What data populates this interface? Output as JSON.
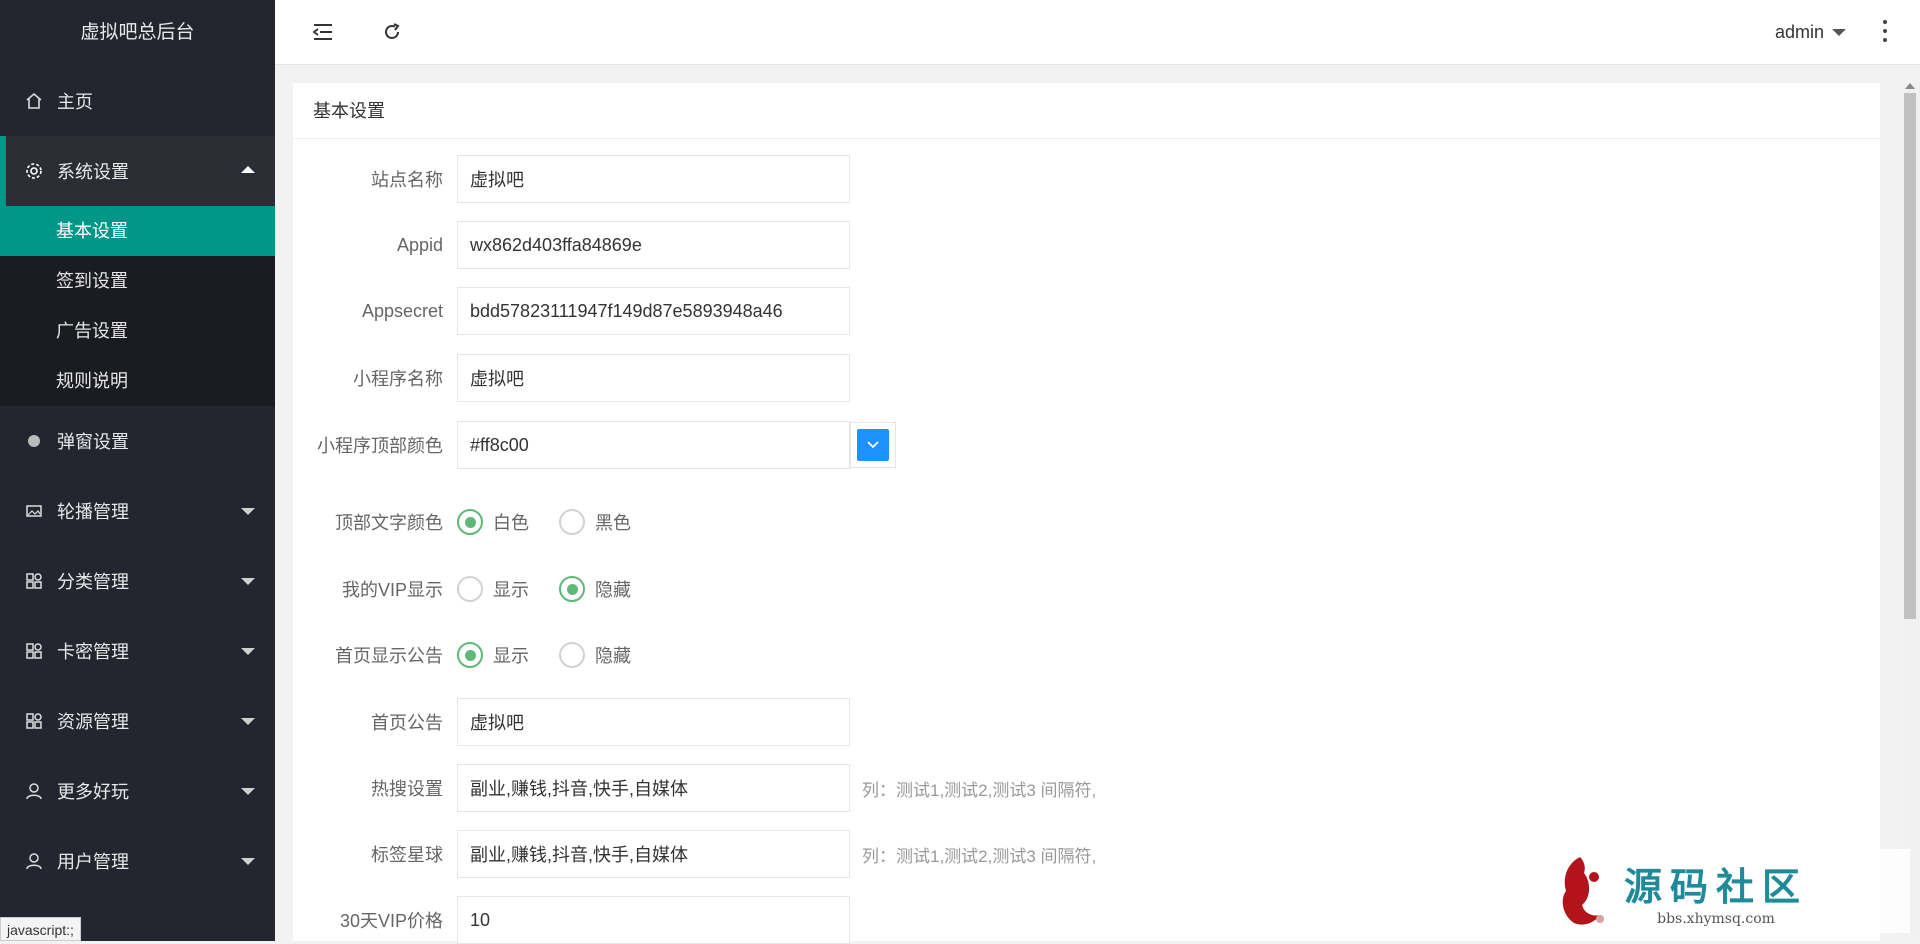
{
  "sidebar": {
    "brand": "虚拟吧总后台",
    "items": [
      {
        "label": "主页",
        "icon": "home-icon"
      },
      {
        "label": "系统设置",
        "icon": "gear-icon"
      },
      {
        "label": "弹窗设置",
        "icon": "dot-icon"
      },
      {
        "label": "轮播管理",
        "icon": "image-icon"
      },
      {
        "label": "分类管理",
        "icon": "apps-icon"
      },
      {
        "label": "卡密管理",
        "icon": "apps-icon"
      },
      {
        "label": "资源管理",
        "icon": "apps-icon"
      },
      {
        "label": "更多好玩",
        "icon": "user-icon"
      },
      {
        "label": "用户管理",
        "icon": "user-icon"
      }
    ],
    "submenu": [
      "基本设置",
      "签到设置",
      "广告设置",
      "规则说明"
    ]
  },
  "topbar": {
    "user": "admin"
  },
  "card": {
    "title": "基本设置"
  },
  "form": {
    "site_name": {
      "label": "站点名称",
      "value": "虚拟吧"
    },
    "appid": {
      "label": "Appid",
      "value": "wx862d403ffa84869e"
    },
    "appsecret": {
      "label": "Appsecret",
      "value": "bdd57823111947f149d87e5893948a46"
    },
    "mp_name": {
      "label": "小程序名称",
      "value": "虚拟吧"
    },
    "top_color": {
      "label": "小程序顶部颜色",
      "value": "#ff8c00"
    },
    "text_color": {
      "label": "顶部文字颜色",
      "options": [
        "白色",
        "黑色"
      ],
      "selected": "白色"
    },
    "vip_show": {
      "label": "我的VIP显示",
      "options": [
        "显示",
        "隐藏"
      ],
      "selected": "隐藏"
    },
    "notice_show": {
      "label": "首页显示公告",
      "options": [
        "显示",
        "隐藏"
      ],
      "selected": "显示"
    },
    "notice": {
      "label": "首页公告",
      "value": "虚拟吧"
    },
    "hot_search": {
      "label": "热搜设置",
      "value": "副业,赚钱,抖音,快手,自媒体",
      "hint": "列：测试1,测试2,测试3 间隔符,"
    },
    "tags": {
      "label": "标签星球",
      "value": "副业,赚钱,抖音,快手,自媒体",
      "hint": "列：测试1,测试2,测试3 间隔符,"
    },
    "vip30": {
      "label": "30天VIP价格",
      "value": "10"
    }
  },
  "status_bar": "javascript:;",
  "watermark": {
    "title": "源码社区",
    "url": "bbs.xhymsq.com"
  },
  "colors": {
    "sidebar": "#23262e",
    "accent": "#009688",
    "radio": "#5fb878",
    "color_button": "#1e90ff"
  }
}
